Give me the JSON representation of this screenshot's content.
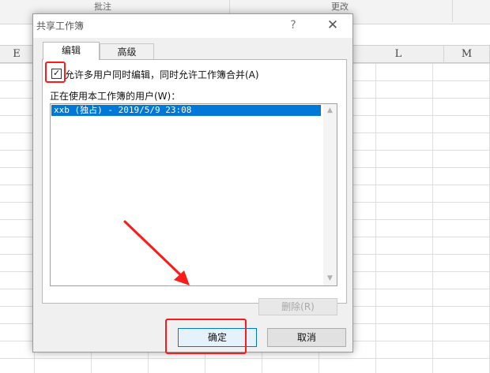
{
  "ribbon": {
    "group1_label": "批注",
    "group2_label": "更改"
  },
  "columns": [
    "E",
    "L",
    "M"
  ],
  "dialog": {
    "title": "共享工作簿",
    "help_glyph": "?",
    "close_glyph": "✕",
    "tabs": [
      {
        "label": "编辑",
        "active": true
      },
      {
        "label": "高级",
        "active": false
      }
    ],
    "allow_multi_user": {
      "checked": true,
      "check_glyph": "✓",
      "label": "允许多用户同时编辑，同时允许工作簿合并(A)"
    },
    "users_label": "正在使用本工作簿的用户(W)：",
    "users": [
      "xxb (独占) - 2019/5/9 23:08"
    ],
    "remove_label": "删除(R)",
    "ok_label": "确定",
    "cancel_label": "取消"
  },
  "colors": {
    "highlight": "#ff1a1a",
    "selection": "#0078d7"
  }
}
